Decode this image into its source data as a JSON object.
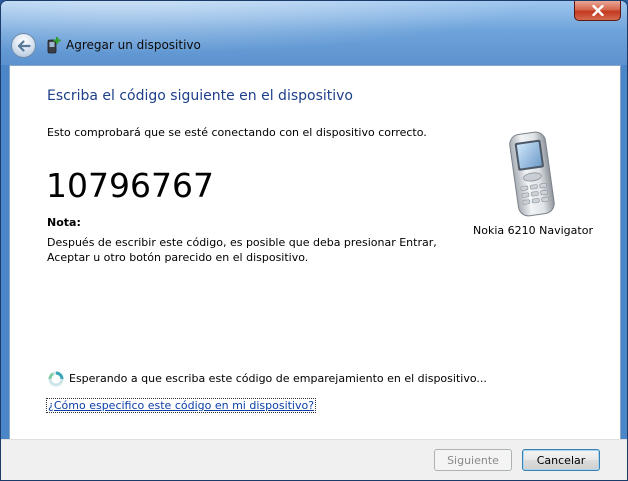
{
  "window": {
    "title": "Agregar un dispositivo"
  },
  "main": {
    "heading": "Escriba el código siguiente en el dispositivo",
    "description": "Esto comprobará que se esté conectando con el dispositivo correcto.",
    "pairing_code": "10796767",
    "note_label": "Nota:",
    "note_line1": "Después de escribir este código, es posible que deba presionar Entrar,",
    "note_line2": "Aceptar u otro botón parecido en el dispositivo.",
    "device_name": "Nokia 6210 Navigator",
    "waiting_text": "Esperando a que escriba este código de emparejamiento en el dispositivo...",
    "help_link": "¿Cómo especifico este código en mi dispositivo?"
  },
  "footer": {
    "next_label": "Siguiente",
    "cancel_label": "Cancelar"
  },
  "icons": {
    "close": "close-icon",
    "back": "back-arrow-icon",
    "title": "add-device-icon",
    "device": "mobile-phone-icon",
    "spinner": "busy-spinner-icon"
  },
  "colors": {
    "heading": "#1e3f8a",
    "link": "#0b3fa8",
    "close_button": "#c2391f"
  }
}
